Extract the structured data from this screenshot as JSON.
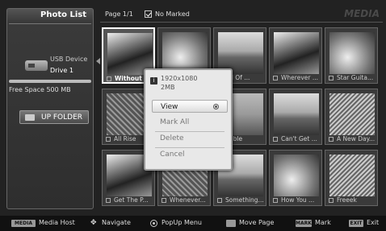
{
  "sidebar": {
    "title": "Photo List",
    "device_label": "USB Device",
    "drive_label": "Drive 1",
    "free_space": "Free Space 500 MB",
    "up_folder_label": "UP FOLDER"
  },
  "header": {
    "page": "Page 1/1",
    "marked": "No Marked",
    "brand": "MEDIA"
  },
  "photos": [
    {
      "label": "Without ...",
      "thumb": "v1"
    },
    {
      "label": "",
      "thumb": "v3"
    },
    {
      "label": "rld Of ...",
      "thumb": "v4"
    },
    {
      "label": "Wherever ...",
      "thumb": "v1"
    },
    {
      "label": "Star Guita...",
      "thumb": "v3"
    },
    {
      "label": "All Rise",
      "thumb": "v2"
    },
    {
      "label": "",
      "thumb": "v5"
    },
    {
      "label": "tiable",
      "thumb": "v5"
    },
    {
      "label": "Can't Get ...",
      "thumb": "v4"
    },
    {
      "label": "A New Day...",
      "thumb": "v6"
    },
    {
      "label": "Get The P...",
      "thumb": "v1"
    },
    {
      "label": "Whenever...",
      "thumb": "v2"
    },
    {
      "label": "Something...",
      "thumb": "v4"
    },
    {
      "label": "How You ...",
      "thumb": "v3"
    },
    {
      "label": "Freeek",
      "thumb": "v6"
    }
  ],
  "popup": {
    "resolution": "1920x1080",
    "size": "2MB",
    "items": [
      "View",
      "Mark All",
      "Delete",
      "Cancel"
    ]
  },
  "bottom_bar": {
    "media_host_chip": "MEDIA HOST",
    "media_host": "Media Host",
    "navigate": "Navigate",
    "popup_menu": "PopUp Menu",
    "move_page": "Move Page",
    "mark_chip": "MARK",
    "mark": "Mark",
    "exit_chip": "EXIT",
    "exit": "Exit"
  }
}
